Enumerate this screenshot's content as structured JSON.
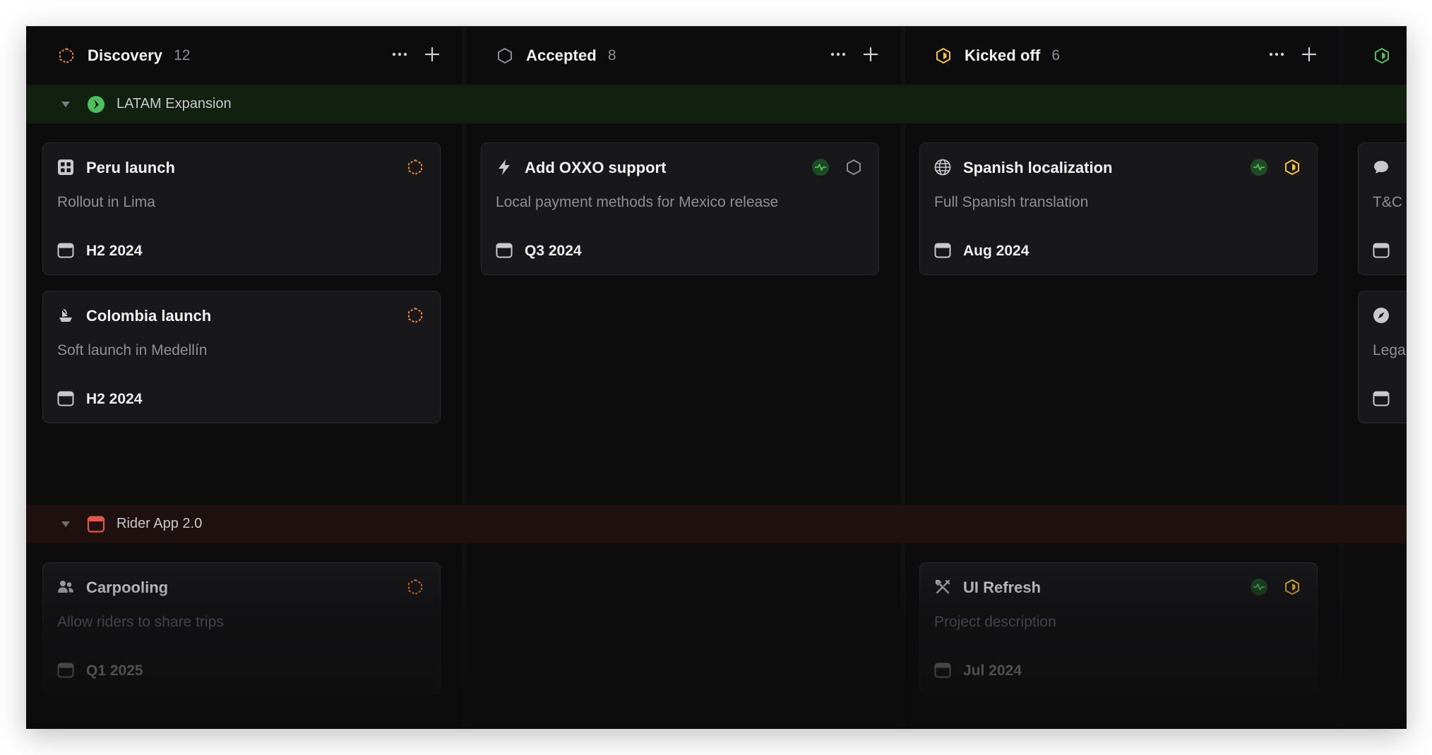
{
  "colors": {
    "background": "#0c0c0d",
    "card": "#18181a",
    "discovery": "#e5833a",
    "accepted": "#8a8a90",
    "kicked_off": "#f2c23a",
    "in_progress": "#4cbf5a",
    "latam_bg": "#11200f",
    "rider_bg": "#1f1110",
    "health_on_track": "#2f9e44"
  },
  "columns": [
    {
      "title": "Discovery",
      "count": "12",
      "status_icon": "hexagon-dashed-icon"
    },
    {
      "title": "Accepted",
      "count": "8",
      "status_icon": "hexagon-outline-icon"
    },
    {
      "title": "Kicked off",
      "count": "6",
      "status_icon": "hexagon-half-icon"
    }
  ],
  "groups": [
    {
      "name": "LATAM Expansion",
      "icon": "arrow-badge-icon"
    },
    {
      "name": "Rider App 2.0",
      "icon": "calendar-badge-icon"
    }
  ],
  "cards": {
    "peru": {
      "title": "Peru launch",
      "desc": "Rollout in Lima",
      "date": "H2 2024",
      "icon": "grid-icon"
    },
    "colombia": {
      "title": "Colombia launch",
      "desc": "Soft launch in Medellín",
      "date": "H2 2024",
      "icon": "ship-icon"
    },
    "oxxo": {
      "title": "Add OXXO support",
      "desc": "Local payment methods for Mexico release",
      "date": "Q3 2024",
      "icon": "lightning-icon"
    },
    "spanish": {
      "title": "Spanish localization",
      "desc": "Full Spanish translation",
      "date": "Aug 2024",
      "icon": "globe-icon"
    },
    "tc": {
      "title": "",
      "desc": "T&C",
      "date": "",
      "icon": "chat-bubble-icon"
    },
    "legal": {
      "title": "",
      "desc": "Lega",
      "date": "",
      "icon": "compass-icon"
    },
    "carpooling": {
      "title": "Carpooling",
      "desc": "Allow riders to share trips",
      "date": "Q1 2025",
      "icon": "users-icon"
    },
    "ui_refresh": {
      "title": "UI Refresh",
      "desc": "Project description",
      "date": "Jul 2024",
      "icon": "tools-icon"
    }
  }
}
